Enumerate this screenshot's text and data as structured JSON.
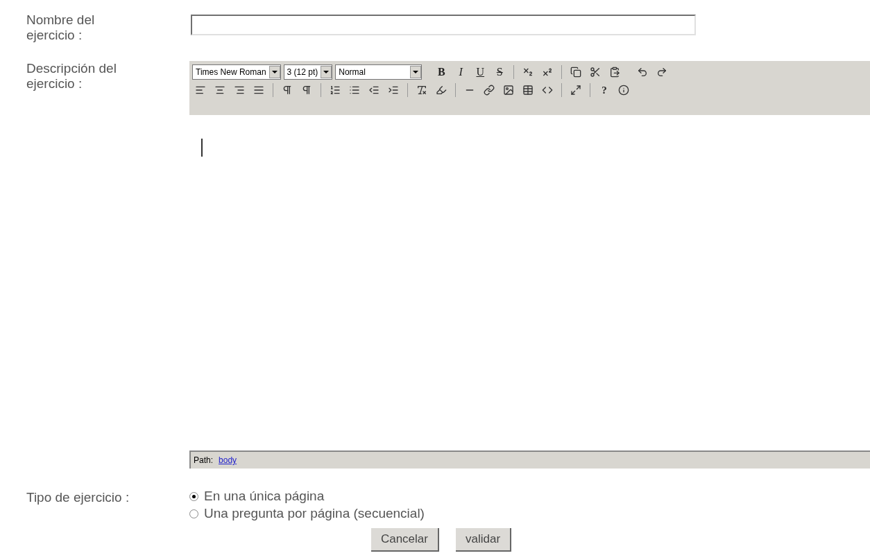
{
  "name_field": {
    "label": "Nombre del ejercicio :"
  },
  "description": {
    "label": "Descripción del ejercicio :",
    "selects": [
      "Times New Roman",
      "3 (12 pt)",
      "Normal"
    ],
    "format_buttons": [
      "B",
      "I",
      "U",
      "S"
    ],
    "help_button": "?",
    "path_label": "Path:",
    "path_link": "body"
  },
  "type": {
    "label": "Tipo de ejercicio :",
    "options": [
      {
        "label": "En una única página",
        "selected": true
      },
      {
        "label": "Una pregunta por página (secuencial)",
        "selected": false
      }
    ]
  },
  "buttons": [
    "Cancelar",
    "validar"
  ]
}
